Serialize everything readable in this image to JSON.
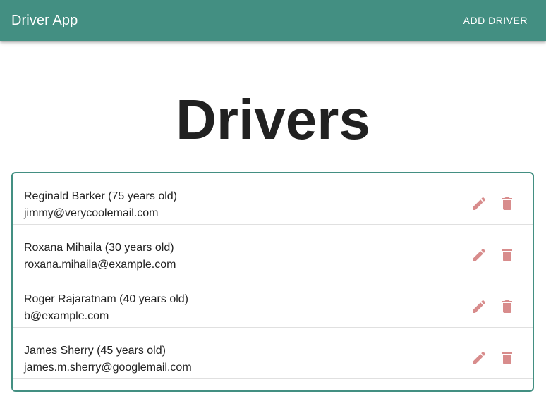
{
  "appbar": {
    "title": "Driver App",
    "add_label": "ADD DRIVER"
  },
  "page": {
    "title": "Drivers"
  },
  "icons": {
    "edit": "pencil-icon",
    "delete": "trash-icon",
    "icon_color": "#d88c8c"
  },
  "colors": {
    "primary": "#438f82"
  },
  "drivers": [
    {
      "name": "Reginald Barker (75 years old)",
      "email": "jimmy@verycoolemail.com"
    },
    {
      "name": "Roxana Mihaila (30 years old)",
      "email": "roxana.mihaila@example.com"
    },
    {
      "name": "Roger Rajaratnam (40 years old)",
      "email": "b@example.com"
    },
    {
      "name": "James Sherry (45 years old)",
      "email": "james.m.sherry@googlemail.com"
    }
  ]
}
